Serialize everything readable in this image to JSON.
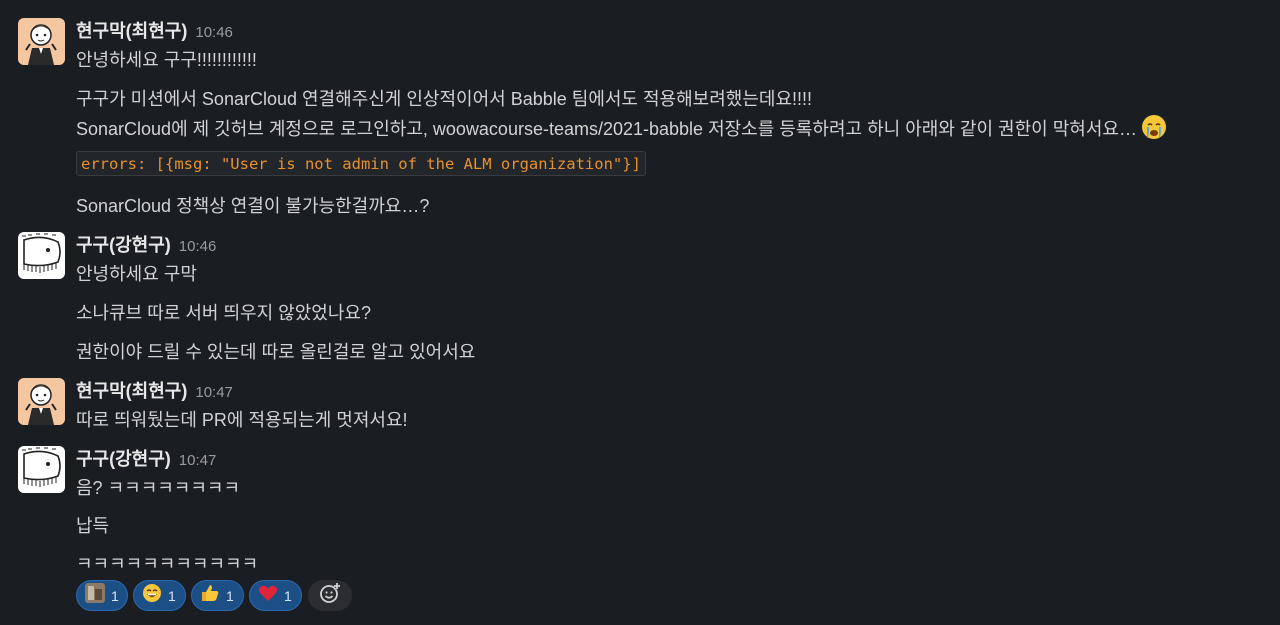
{
  "messages": [
    {
      "author": "현구막(최현구)",
      "time": "10:46",
      "avatar": "person-illustration-avatar",
      "lines": [
        "안녕하세요 구구!!!!!!!!!!!!",
        "구구가 미션에서 SonarCloud 연결해주신게 인상적이어서 Babble 팀에서도 적용해보려했는데요!!!!",
        "SonarCloud에 제 깃허브 계정으로 로그인하고, woowacourse-teams/2021-babble 저장소를 등록하려고 하니 아래와 같이 권한이 막혀서요…",
        "SonarCloud 정책상 연결이 불가능한걸까요…?"
      ],
      "code": "errors: [{msg: \"User is not admin of the ALM organization\"}]",
      "inline_emoji": "crying-face-emoji"
    },
    {
      "author": "구구(강현구)",
      "time": "10:46",
      "avatar": "whale-drawing-avatar",
      "lines": [
        "안녕하세요 구막",
        "소나큐브 따로 서버 띄우지 않았었나요?",
        "권한이야 드릴 수 있는데 따로 올린걸로 알고 있어서요"
      ]
    },
    {
      "author": "현구막(최현구)",
      "time": "10:47",
      "avatar": "person-illustration-avatar",
      "lines": [
        "따로 띄워뒀는데 PR에 적용되는게 멋져서요!"
      ]
    },
    {
      "author": "구구(강현구)",
      "time": "10:47",
      "avatar": "whale-drawing-avatar",
      "lines": [
        "음? ㅋㅋㅋㅋㅋㅋㅋㅋ",
        "납득",
        "ㅋㅋㅋㅋㅋㅋㅋㅋㅋㅋㅋ"
      ]
    }
  ],
  "reactions": [
    {
      "emoji": "custom-photo-emoji",
      "count": "1"
    },
    {
      "emoji": "grinning-face-emoji",
      "count": "1"
    },
    {
      "emoji": "thumbs-up-emoji",
      "count": "1"
    },
    {
      "emoji": "red-heart-emoji",
      "count": "1"
    }
  ],
  "add_reaction_icon": "add-reaction-icon",
  "colors": {
    "background": "#1a1d21",
    "text": "#d1d2d3",
    "code_text": "#e8912d",
    "reaction_bg": "#1d4f87"
  }
}
